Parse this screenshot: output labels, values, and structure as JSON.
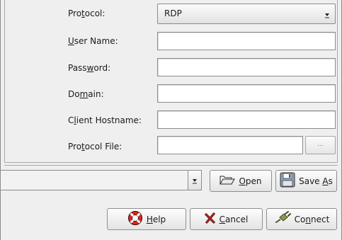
{
  "form": {
    "protocol": {
      "label_pre": "Pro",
      "label_ul": "t",
      "label_post": "ocol:",
      "value": "RDP"
    },
    "user_name": {
      "label_pre": "",
      "label_ul": "U",
      "label_post": "ser Name:",
      "value": ""
    },
    "password": {
      "label_pre": "Pass",
      "label_ul": "w",
      "label_post": "ord:",
      "value": ""
    },
    "domain": {
      "label_pre": "Do",
      "label_ul": "m",
      "label_post": "ain:",
      "value": ""
    },
    "client_hostname": {
      "label_pre": "C",
      "label_ul": "l",
      "label_post": "ient Hostname:",
      "value": ""
    },
    "protocol_file": {
      "label_pre": "Pro",
      "label_ul": "t",
      "label_post": "ocol File:",
      "value": "",
      "browse_label": "..."
    }
  },
  "profile_combo": {
    "value": ""
  },
  "buttons": {
    "open": {
      "ul": "O",
      "rest": "pen",
      "icon": "folder-open-icon"
    },
    "save_as": {
      "pre": "Save ",
      "ul": "A",
      "rest": "s",
      "icon": "floppy-disk-icon"
    },
    "help": {
      "ul": "H",
      "rest": "elp",
      "icon": "lifebuoy-icon"
    },
    "cancel": {
      "ul": "C",
      "rest": "ancel",
      "icon": "red-x-icon"
    },
    "connect": {
      "pre": "Co",
      "ul": "n",
      "rest": "nect",
      "icon": "plug-icon"
    }
  },
  "colors": {
    "background": "#efefef",
    "border": "#8c8c8c",
    "cancel_x": "#d21414",
    "lifebuoy": "#d42a20"
  }
}
